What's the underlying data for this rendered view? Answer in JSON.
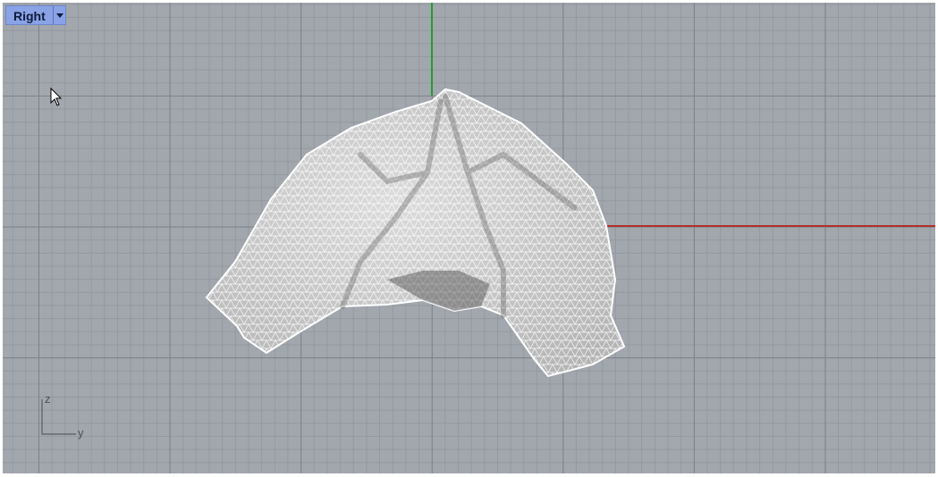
{
  "viewport": {
    "name": "Right",
    "dropdown_icon": "chevron-down-icon",
    "background": "#a2a7ae",
    "axis_colors": {
      "x": "#b0302a",
      "z": "#1f9e2b"
    }
  },
  "axis_widget": {
    "vertical_label": "z",
    "horizontal_label": "y"
  },
  "mesh": {
    "display": "wireframe-shaded",
    "color": "#eeeeee"
  }
}
